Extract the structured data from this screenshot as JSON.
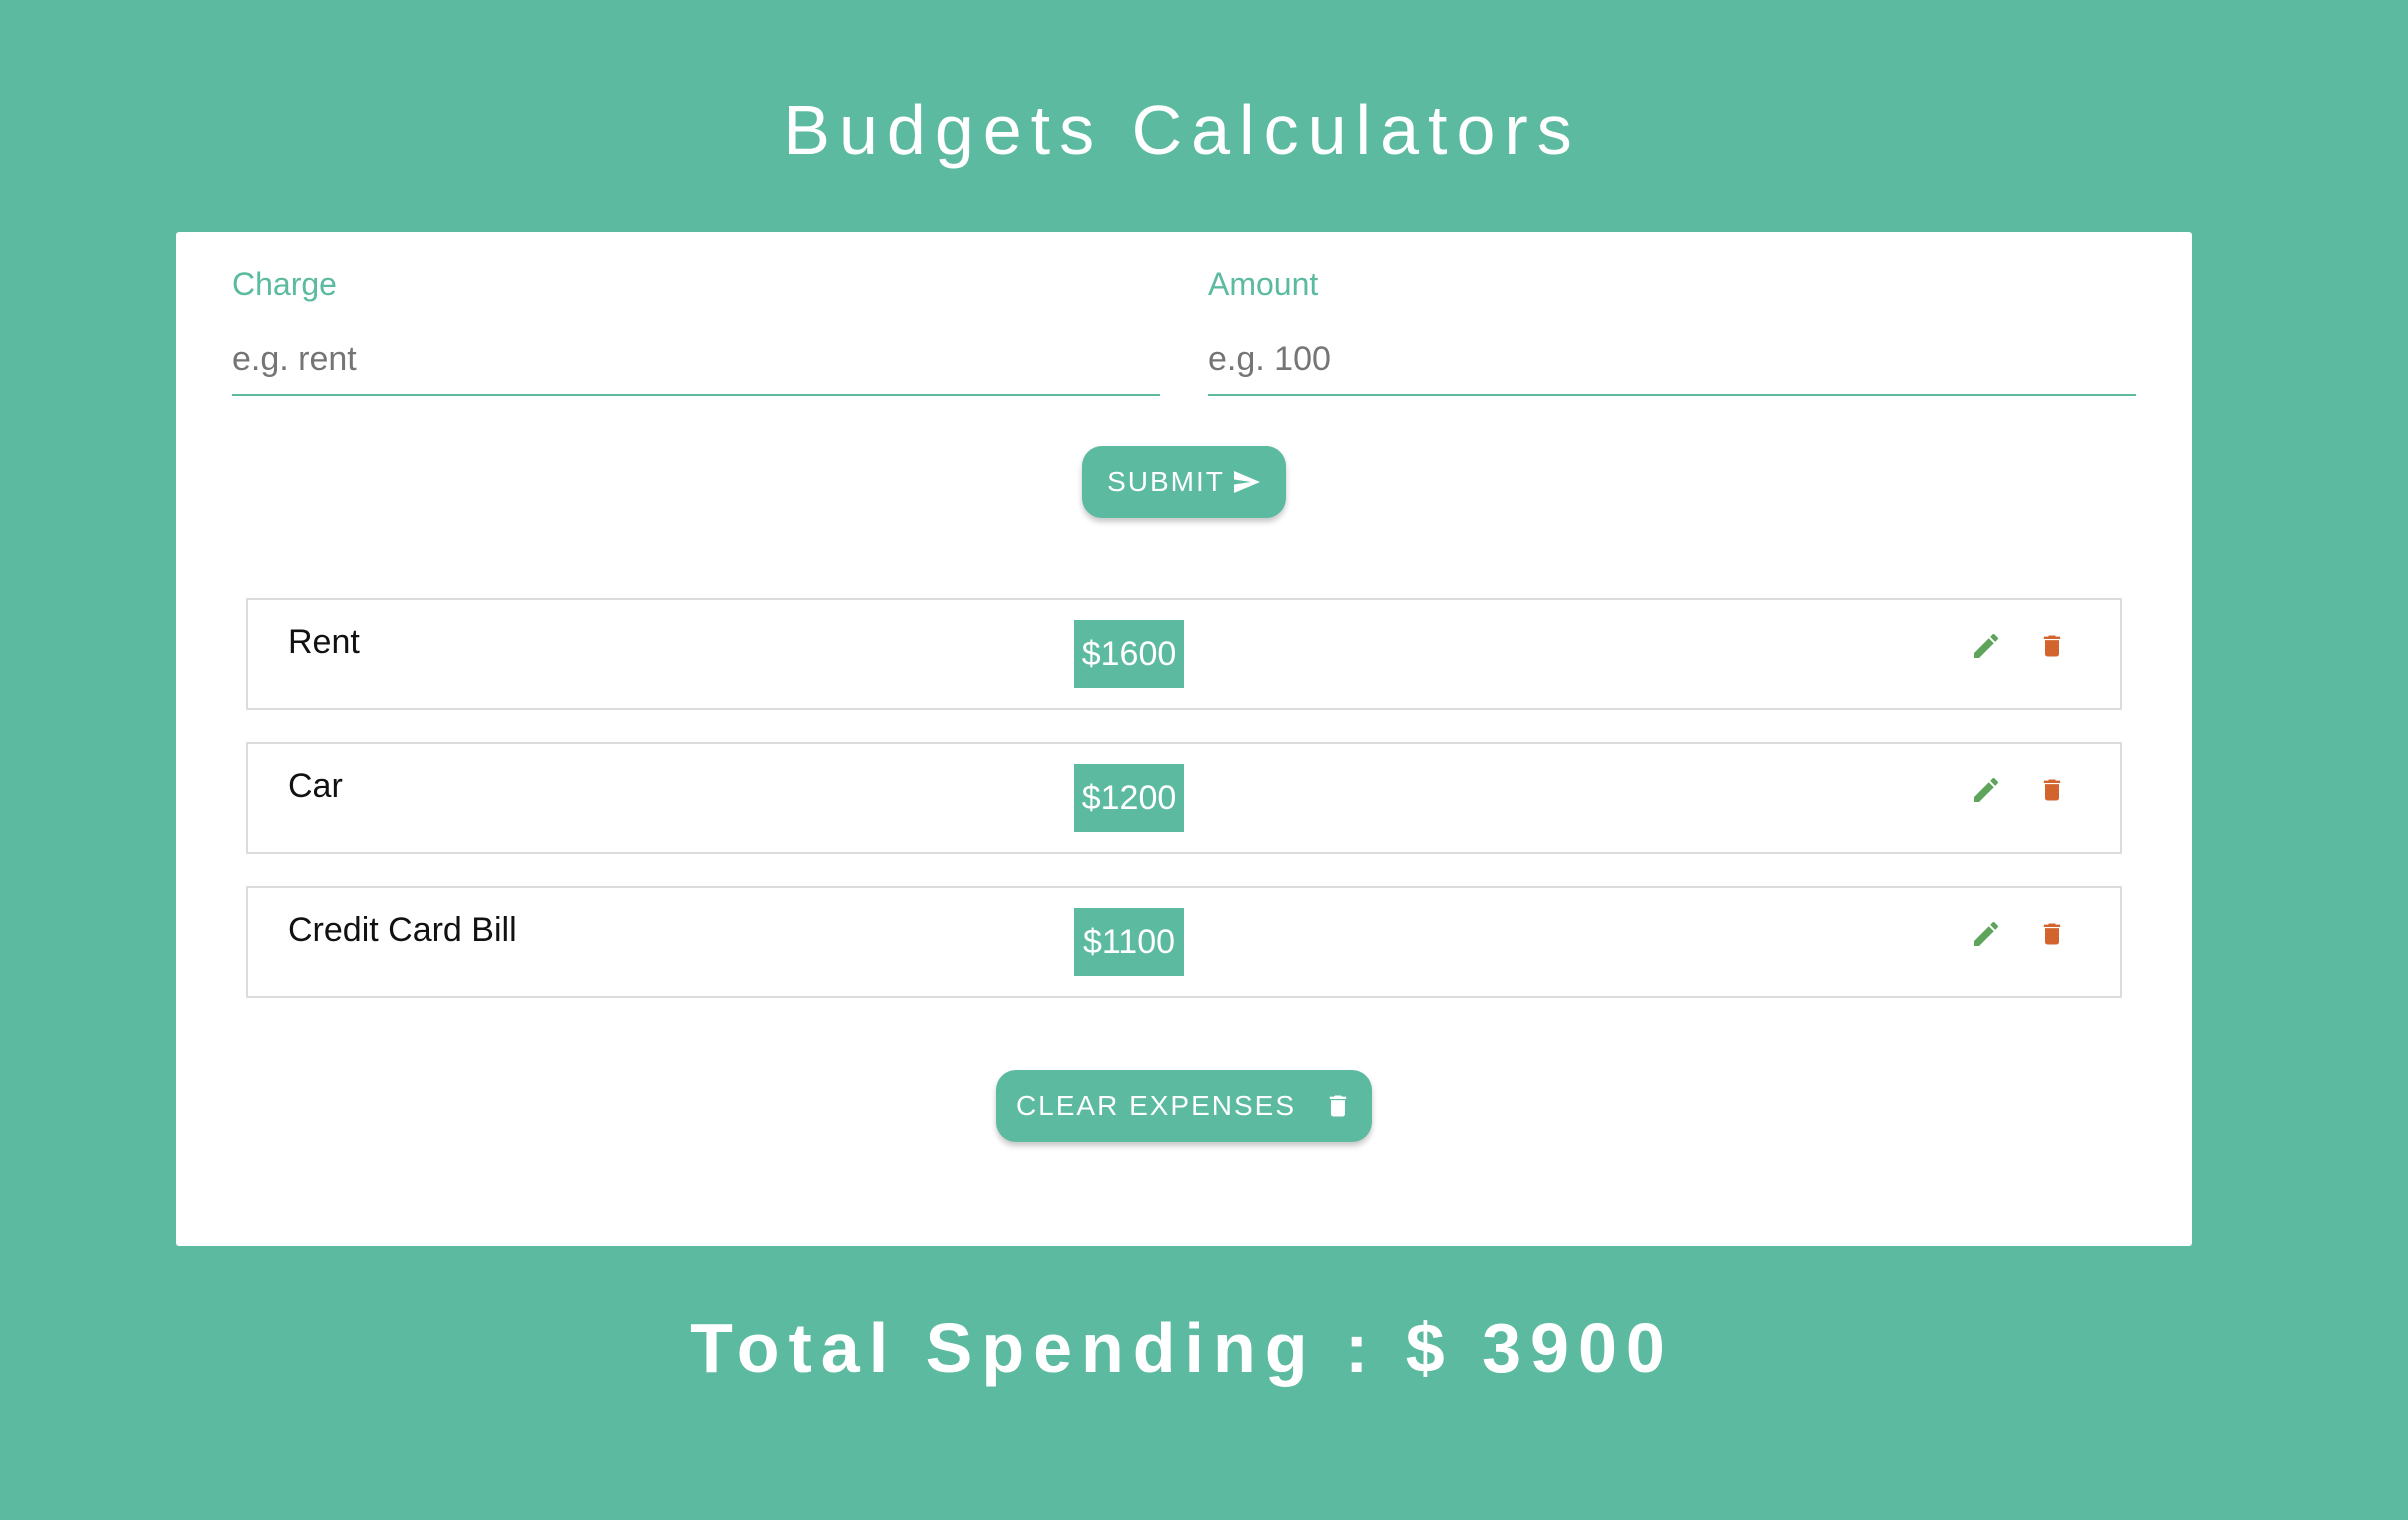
{
  "app": {
    "title": "Budgets Calculators"
  },
  "form": {
    "charge": {
      "label": "Charge",
      "placeholder": "e.g. rent",
      "value": ""
    },
    "amount": {
      "label": "Amount",
      "placeholder": "e.g. 100",
      "value": ""
    },
    "submit_label": "SUBMIT"
  },
  "expenses": [
    {
      "name": "Rent",
      "amount": "$1600"
    },
    {
      "name": "Car",
      "amount": "$1200"
    },
    {
      "name": "Credit Card Bill",
      "amount": "$1100"
    }
  ],
  "clear_label": "CLEAR EXPENSES",
  "total": {
    "text": "Total Spending : $ 3900"
  },
  "icons": {
    "submit": "send-icon",
    "edit": "pencil-icon",
    "delete": "trash-icon",
    "clear": "trash-icon"
  },
  "colors": {
    "background": "#5bba9f",
    "accent": "#5bba9f",
    "edit": "#5ea55b",
    "delete": "#d2652d",
    "card": "#ffffff"
  }
}
